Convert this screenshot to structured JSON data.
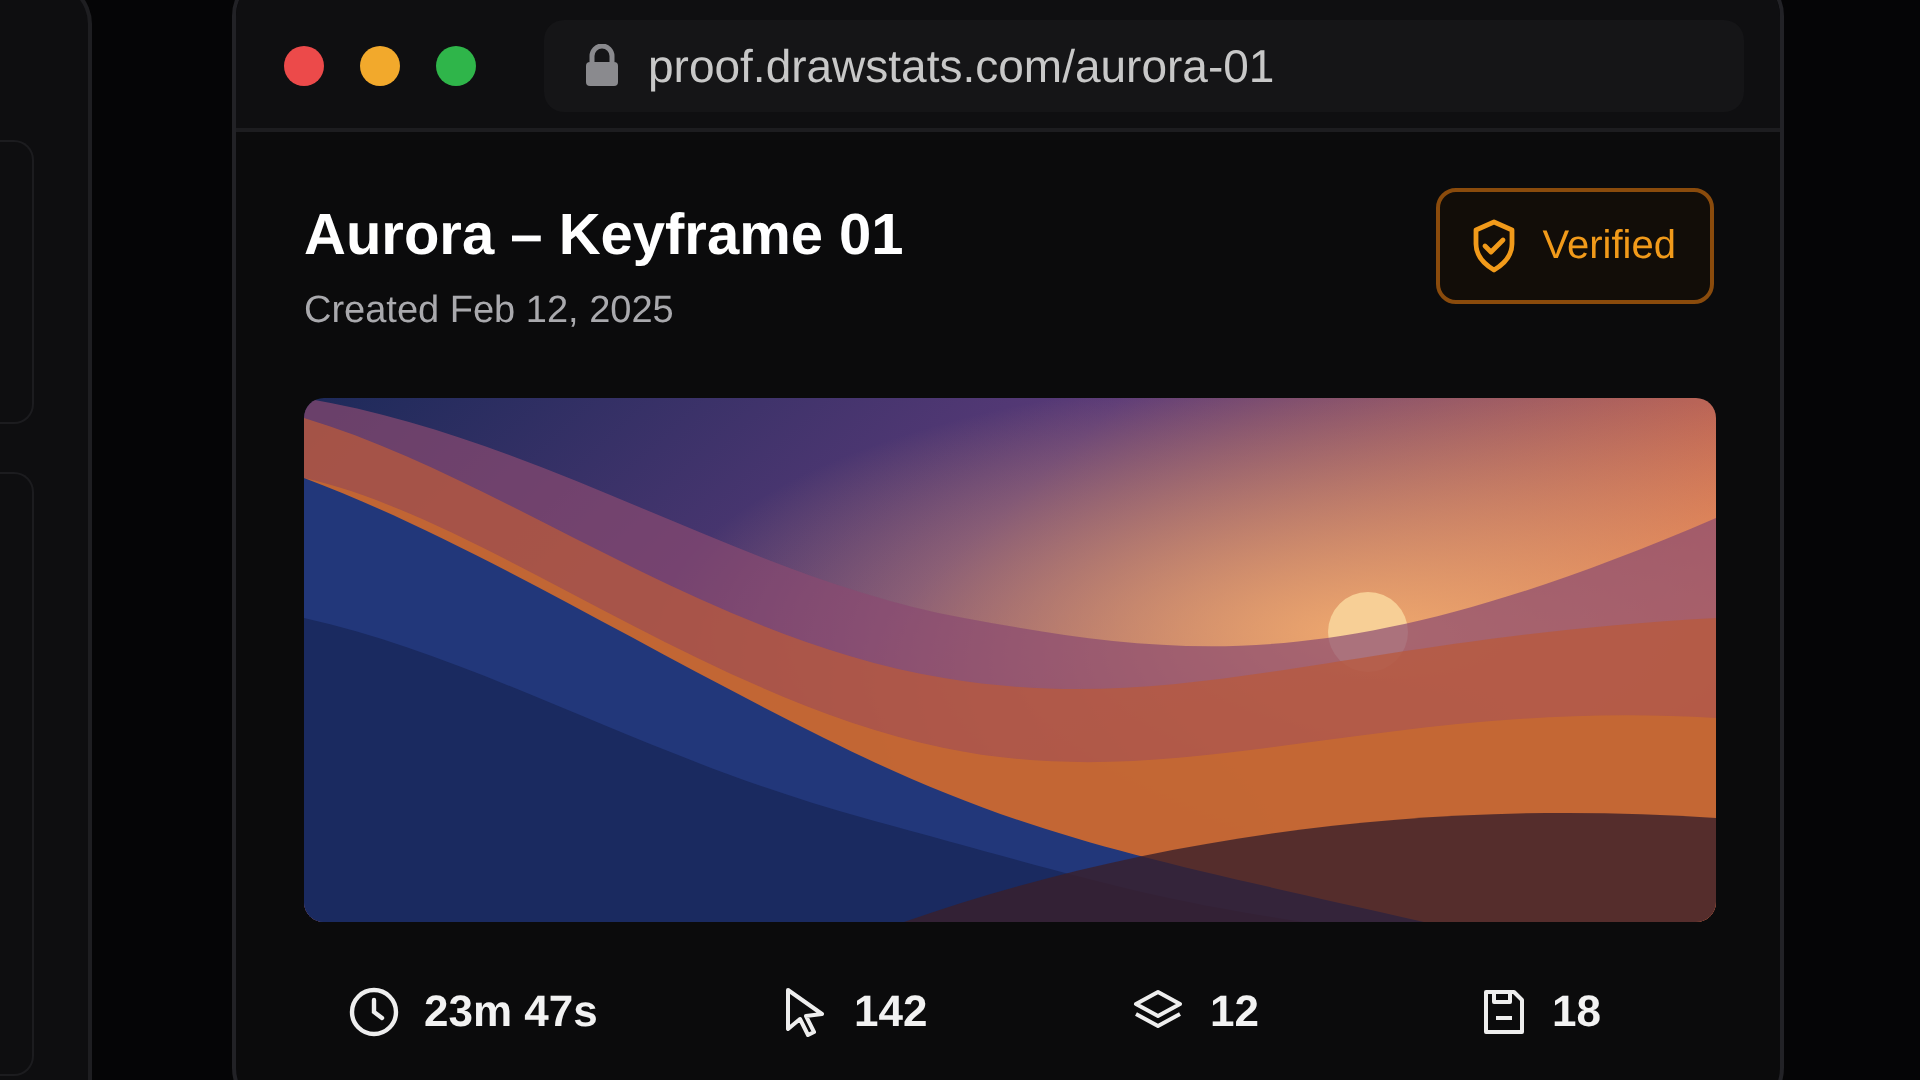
{
  "address_bar": {
    "url": "proof.drawstats.com/aurora-01"
  },
  "header": {
    "title": "Aurora – Keyframe 01",
    "created": "Created Feb 12, 2025",
    "badge": {
      "label": "Verified",
      "verified": true
    }
  },
  "stats": [
    {
      "kind": "time",
      "value": "23m 47s"
    },
    {
      "kind": "clicks",
      "value": "142"
    },
    {
      "kind": "layers",
      "value": "12"
    },
    {
      "kind": "saves",
      "value": "18"
    }
  ]
}
